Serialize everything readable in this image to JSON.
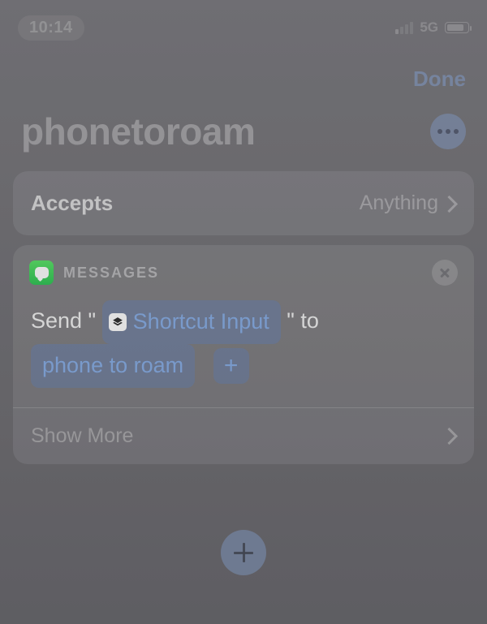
{
  "statusBar": {
    "time": "10:14",
    "network": "5G"
  },
  "nav": {
    "done": "Done"
  },
  "title": "phonetoroam",
  "acceptsRow": {
    "label": "Accepts",
    "value": "Anything"
  },
  "action": {
    "appName": "MESSAGES",
    "text": {
      "prefix": "Send \"",
      "inputToken": "Shortcut Input",
      "mid": "\" to",
      "recipientToken": "phone to roam"
    },
    "showMore": "Show More"
  }
}
